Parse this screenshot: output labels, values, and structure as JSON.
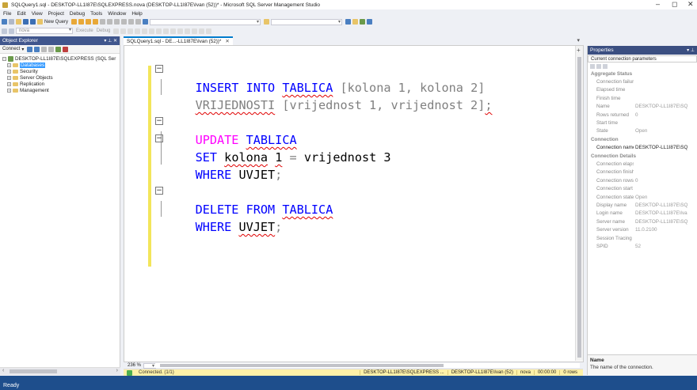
{
  "window": {
    "title": "SQLQuery1.sql - DESKTOP-LL1I87E\\SQLEXPRESS.nova (DESKTOP-LL1I87E\\Ivan (52))* - Microsoft SQL Server Management Studio",
    "minimize": "–",
    "maximize": "◻",
    "close": "✕"
  },
  "menu": [
    "File",
    "Edit",
    "View",
    "Project",
    "Debug",
    "Tools",
    "Window",
    "Help"
  ],
  "toolbar": {
    "new_query": "New Query",
    "database": "nova",
    "execute": "Execute",
    "debug": "Debug"
  },
  "object_explorer": {
    "title": "Object Explorer",
    "connect": "Connect",
    "server": "DESKTOP-LL1I87E\\SQLEXPRESS (SQL Ser",
    "nodes": [
      "Databases",
      "Security",
      "Server Objects",
      "Replication",
      "Management"
    ]
  },
  "editor": {
    "tab_label": "SQLQuery1.sql - DE...-LL1I87E\\Ivan (52))*",
    "tab_close": "✕",
    "lines": {
      "l1_kw": "INSERT INTO",
      "l1_tbl": "TABLICA",
      "l1_rest": " [kolona 1, kolona 2]",
      "l2_kw": "VRIJEDNOSTI",
      "l2_rest": " [vrijednost 1, vrijednost 2]",
      "l2_end": ";",
      "l4_kw": "UPDATE",
      "l4_tbl": "TABLICA",
      "l5_kw": "SET",
      "l5_col": "kolona",
      "l5_num": "1",
      "l5_eq": "=",
      "l5_rest": " vrijednost 3",
      "l6_kw": "WHERE",
      "l6_cond": "UVJET",
      "l6_end": ";",
      "l8_kw": "DELETE FROM",
      "l8_tbl": "TABLICA",
      "l9_kw": "WHERE",
      "l9_cond": "UVJET",
      "l9_end": ";"
    },
    "zoom": "236 %"
  },
  "query_status": {
    "state": "Connected. (1/1)",
    "server": "DESKTOP-LL1I87E\\SQLEXPRESS ...",
    "user": "DESKTOP-LL1I87E\\Ivan (52)",
    "database": "nova",
    "time": "00:00:00",
    "rows": "0 rows"
  },
  "properties": {
    "title": "Properties",
    "object": "Current connection parameters",
    "rows": [
      {
        "type": "cat",
        "label": "Aggregate Status"
      },
      {
        "type": "row",
        "key": "Connection failure",
        "value": ""
      },
      {
        "type": "row",
        "key": "Elapsed time",
        "value": ""
      },
      {
        "type": "row",
        "key": "Finish time",
        "value": ""
      },
      {
        "type": "row",
        "key": "Name",
        "value": "DESKTOP-LL1I87E\\SQ"
      },
      {
        "type": "row",
        "key": "Rows returned",
        "value": "0"
      },
      {
        "type": "row",
        "key": "Start time",
        "value": ""
      },
      {
        "type": "row",
        "key": "State",
        "value": "Open"
      },
      {
        "type": "cat",
        "label": "Connection"
      },
      {
        "type": "act",
        "key": "Connection name",
        "value": "DESKTOP-LL1I87E\\SQ"
      },
      {
        "type": "cat",
        "label": "Connection Details"
      },
      {
        "type": "row",
        "key": "Connection elapse",
        "value": ""
      },
      {
        "type": "row",
        "key": "Connection finish t",
        "value": ""
      },
      {
        "type": "row",
        "key": "Connection rows r",
        "value": "0"
      },
      {
        "type": "row",
        "key": "Connection start ti",
        "value": ""
      },
      {
        "type": "row",
        "key": "Connection state",
        "value": "Open"
      },
      {
        "type": "row",
        "key": "Display name",
        "value": "DESKTOP-LL1I87E\\SQ"
      },
      {
        "type": "row",
        "key": "Login name",
        "value": "DESKTOP-LL1I87E\\Iva"
      },
      {
        "type": "row",
        "key": "Server name",
        "value": "DESKTOP-LL1I87E\\SQ"
      },
      {
        "type": "row",
        "key": "Server version",
        "value": "11.0.2100"
      },
      {
        "type": "row",
        "key": "Session Tracing ID",
        "value": ""
      },
      {
        "type": "row",
        "key": "SPID",
        "value": "52"
      }
    ],
    "desc_title": "Name",
    "desc_text": "The name of the connection."
  },
  "status": {
    "ready": "Ready"
  },
  "colors": {
    "keyword": "#0000ff",
    "update_keyword": "#ff00ff",
    "squiggle": "#e00000",
    "status_bar": "#1e4e8c",
    "margin": "#f3e55a"
  }
}
